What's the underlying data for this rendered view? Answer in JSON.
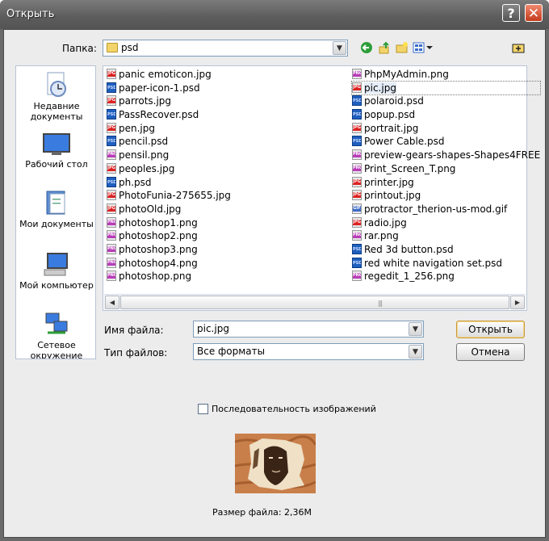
{
  "window": {
    "title": "Открыть"
  },
  "folder": {
    "label": "Папка:",
    "value": "psd"
  },
  "places": [
    {
      "label": "Недавние документы",
      "icon": "recent-documents-icon"
    },
    {
      "label": "Рабочий стол",
      "icon": "desktop-icon"
    },
    {
      "label": "Мои документы",
      "icon": "my-documents-icon"
    },
    {
      "label": "Мой компьютер",
      "icon": "my-computer-icon"
    },
    {
      "label": "Сетевое окружение",
      "icon": "network-icon"
    }
  ],
  "files": {
    "left": [
      {
        "name": "panic emoticon.jpg",
        "type": "JPG"
      },
      {
        "name": "paper-icon-1.psd",
        "type": "PSD"
      },
      {
        "name": "parrots.jpg",
        "type": "JPG"
      },
      {
        "name": "PassRecover.psd",
        "type": "PSD"
      },
      {
        "name": "pen.jpg",
        "type": "JPG"
      },
      {
        "name": "pencil.psd",
        "type": "PSD"
      },
      {
        "name": "pensil.png",
        "type": "PNG"
      },
      {
        "name": "peoples.jpg",
        "type": "JPG"
      },
      {
        "name": "ph.psd",
        "type": "PSD"
      },
      {
        "name": "PhotoFunia-275655.jpg",
        "type": "JPG"
      },
      {
        "name": "photoOld.jpg",
        "type": "JPG"
      },
      {
        "name": "photoshop1.png",
        "type": "PNG"
      },
      {
        "name": "photoshop2.png",
        "type": "PNG"
      },
      {
        "name": "photoshop3.png",
        "type": "PNG"
      },
      {
        "name": "photoshop4.png",
        "type": "PNG"
      },
      {
        "name": "photoshop.png",
        "type": "PNG"
      }
    ],
    "right": [
      {
        "name": "PhpMyAdmin.png",
        "type": "PNG"
      },
      {
        "name": "pic.jpg",
        "type": "JPG"
      },
      {
        "name": "polaroid.psd",
        "type": "PSD"
      },
      {
        "name": "popup.psd",
        "type": "PSD"
      },
      {
        "name": "portrait.jpg",
        "type": "JPG"
      },
      {
        "name": "Power Cable.psd",
        "type": "PSD"
      },
      {
        "name": "preview-gears-shapes-Shapes4FREE",
        "type": "PNG"
      },
      {
        "name": "Print_Screen_T.png",
        "type": "PNG"
      },
      {
        "name": "printer.jpg",
        "type": "JPG"
      },
      {
        "name": "printout.jpg",
        "type": "JPG"
      },
      {
        "name": "protractor_therion-us-mod.gif",
        "type": "GIF"
      },
      {
        "name": "radio.jpg",
        "type": "JPG"
      },
      {
        "name": "rar.png",
        "type": "PNG"
      },
      {
        "name": "Red 3d button.psd",
        "type": "PSD"
      },
      {
        "name": "red white navigation set.psd",
        "type": "PSD"
      },
      {
        "name": "regedit_1_256.png",
        "type": "PNG"
      }
    ],
    "selected": "pic.jpg"
  },
  "filename": {
    "label": "Имя файла:",
    "value": "pic.jpg"
  },
  "filetype": {
    "label": "Тип файлов:",
    "value": "Все форматы"
  },
  "buttons": {
    "open": "Открыть",
    "cancel": "Отмена"
  },
  "sequence": {
    "label": "Последовательность изображений",
    "checked": false
  },
  "preview": {
    "filesize": "Размер файла: 2,36M"
  }
}
